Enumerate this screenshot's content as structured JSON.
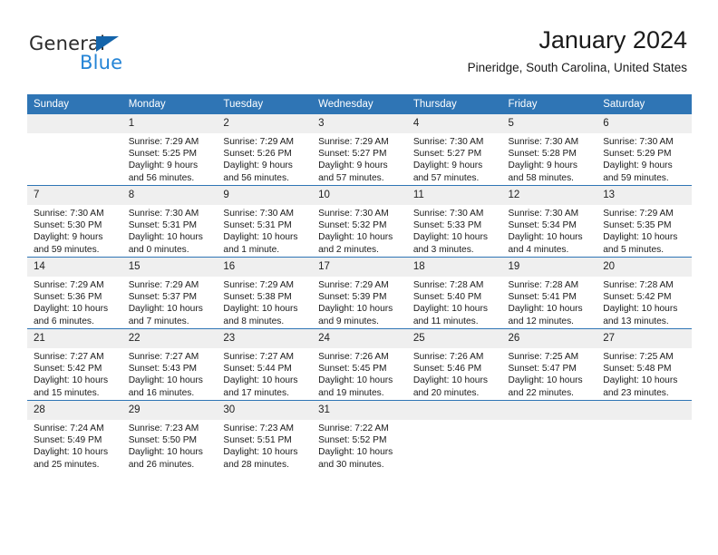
{
  "brand": {
    "word_one": "General",
    "word_two": "Blue",
    "triangle_color": "#1464aa",
    "blue_text_color": "#2484d6"
  },
  "header": {
    "title": "January 2024",
    "location": "Pineridge, South Carolina, United States"
  },
  "theme": {
    "header_blue": "#2f75b5",
    "daynum_band": "#efefef",
    "text": "#1a1a1a"
  },
  "calendar": {
    "weekday_headers": [
      "Sunday",
      "Monday",
      "Tuesday",
      "Wednesday",
      "Thursday",
      "Friday",
      "Saturday"
    ],
    "weeks": [
      [
        {
          "day": "",
          "sunrise": "",
          "sunset": "",
          "daylight": ""
        },
        {
          "day": "1",
          "sunrise": "Sunrise: 7:29 AM",
          "sunset": "Sunset: 5:25 PM",
          "daylight": "Daylight: 9 hours and 56 minutes."
        },
        {
          "day": "2",
          "sunrise": "Sunrise: 7:29 AM",
          "sunset": "Sunset: 5:26 PM",
          "daylight": "Daylight: 9 hours and 56 minutes."
        },
        {
          "day": "3",
          "sunrise": "Sunrise: 7:29 AM",
          "sunset": "Sunset: 5:27 PM",
          "daylight": "Daylight: 9 hours and 57 minutes."
        },
        {
          "day": "4",
          "sunrise": "Sunrise: 7:30 AM",
          "sunset": "Sunset: 5:27 PM",
          "daylight": "Daylight: 9 hours and 57 minutes."
        },
        {
          "day": "5",
          "sunrise": "Sunrise: 7:30 AM",
          "sunset": "Sunset: 5:28 PM",
          "daylight": "Daylight: 9 hours and 58 minutes."
        },
        {
          "day": "6",
          "sunrise": "Sunrise: 7:30 AM",
          "sunset": "Sunset: 5:29 PM",
          "daylight": "Daylight: 9 hours and 59 minutes."
        }
      ],
      [
        {
          "day": "7",
          "sunrise": "Sunrise: 7:30 AM",
          "sunset": "Sunset: 5:30 PM",
          "daylight": "Daylight: 9 hours and 59 minutes."
        },
        {
          "day": "8",
          "sunrise": "Sunrise: 7:30 AM",
          "sunset": "Sunset: 5:31 PM",
          "daylight": "Daylight: 10 hours and 0 minutes."
        },
        {
          "day": "9",
          "sunrise": "Sunrise: 7:30 AM",
          "sunset": "Sunset: 5:31 PM",
          "daylight": "Daylight: 10 hours and 1 minute."
        },
        {
          "day": "10",
          "sunrise": "Sunrise: 7:30 AM",
          "sunset": "Sunset: 5:32 PM",
          "daylight": "Daylight: 10 hours and 2 minutes."
        },
        {
          "day": "11",
          "sunrise": "Sunrise: 7:30 AM",
          "sunset": "Sunset: 5:33 PM",
          "daylight": "Daylight: 10 hours and 3 minutes."
        },
        {
          "day": "12",
          "sunrise": "Sunrise: 7:30 AM",
          "sunset": "Sunset: 5:34 PM",
          "daylight": "Daylight: 10 hours and 4 minutes."
        },
        {
          "day": "13",
          "sunrise": "Sunrise: 7:29 AM",
          "sunset": "Sunset: 5:35 PM",
          "daylight": "Daylight: 10 hours and 5 minutes."
        }
      ],
      [
        {
          "day": "14",
          "sunrise": "Sunrise: 7:29 AM",
          "sunset": "Sunset: 5:36 PM",
          "daylight": "Daylight: 10 hours and 6 minutes."
        },
        {
          "day": "15",
          "sunrise": "Sunrise: 7:29 AM",
          "sunset": "Sunset: 5:37 PM",
          "daylight": "Daylight: 10 hours and 7 minutes."
        },
        {
          "day": "16",
          "sunrise": "Sunrise: 7:29 AM",
          "sunset": "Sunset: 5:38 PM",
          "daylight": "Daylight: 10 hours and 8 minutes."
        },
        {
          "day": "17",
          "sunrise": "Sunrise: 7:29 AM",
          "sunset": "Sunset: 5:39 PM",
          "daylight": "Daylight: 10 hours and 9 minutes."
        },
        {
          "day": "18",
          "sunrise": "Sunrise: 7:28 AM",
          "sunset": "Sunset: 5:40 PM",
          "daylight": "Daylight: 10 hours and 11 minutes."
        },
        {
          "day": "19",
          "sunrise": "Sunrise: 7:28 AM",
          "sunset": "Sunset: 5:41 PM",
          "daylight": "Daylight: 10 hours and 12 minutes."
        },
        {
          "day": "20",
          "sunrise": "Sunrise: 7:28 AM",
          "sunset": "Sunset: 5:42 PM",
          "daylight": "Daylight: 10 hours and 13 minutes."
        }
      ],
      [
        {
          "day": "21",
          "sunrise": "Sunrise: 7:27 AM",
          "sunset": "Sunset: 5:42 PM",
          "daylight": "Daylight: 10 hours and 15 minutes."
        },
        {
          "day": "22",
          "sunrise": "Sunrise: 7:27 AM",
          "sunset": "Sunset: 5:43 PM",
          "daylight": "Daylight: 10 hours and 16 minutes."
        },
        {
          "day": "23",
          "sunrise": "Sunrise: 7:27 AM",
          "sunset": "Sunset: 5:44 PM",
          "daylight": "Daylight: 10 hours and 17 minutes."
        },
        {
          "day": "24",
          "sunrise": "Sunrise: 7:26 AM",
          "sunset": "Sunset: 5:45 PM",
          "daylight": "Daylight: 10 hours and 19 minutes."
        },
        {
          "day": "25",
          "sunrise": "Sunrise: 7:26 AM",
          "sunset": "Sunset: 5:46 PM",
          "daylight": "Daylight: 10 hours and 20 minutes."
        },
        {
          "day": "26",
          "sunrise": "Sunrise: 7:25 AM",
          "sunset": "Sunset: 5:47 PM",
          "daylight": "Daylight: 10 hours and 22 minutes."
        },
        {
          "day": "27",
          "sunrise": "Sunrise: 7:25 AM",
          "sunset": "Sunset: 5:48 PM",
          "daylight": "Daylight: 10 hours and 23 minutes."
        }
      ],
      [
        {
          "day": "28",
          "sunrise": "Sunrise: 7:24 AM",
          "sunset": "Sunset: 5:49 PM",
          "daylight": "Daylight: 10 hours and 25 minutes."
        },
        {
          "day": "29",
          "sunrise": "Sunrise: 7:23 AM",
          "sunset": "Sunset: 5:50 PM",
          "daylight": "Daylight: 10 hours and 26 minutes."
        },
        {
          "day": "30",
          "sunrise": "Sunrise: 7:23 AM",
          "sunset": "Sunset: 5:51 PM",
          "daylight": "Daylight: 10 hours and 28 minutes."
        },
        {
          "day": "31",
          "sunrise": "Sunrise: 7:22 AM",
          "sunset": "Sunset: 5:52 PM",
          "daylight": "Daylight: 10 hours and 30 minutes."
        },
        {
          "day": "",
          "sunrise": "",
          "sunset": "",
          "daylight": ""
        },
        {
          "day": "",
          "sunrise": "",
          "sunset": "",
          "daylight": ""
        },
        {
          "day": "",
          "sunrise": "",
          "sunset": "",
          "daylight": ""
        }
      ]
    ]
  }
}
